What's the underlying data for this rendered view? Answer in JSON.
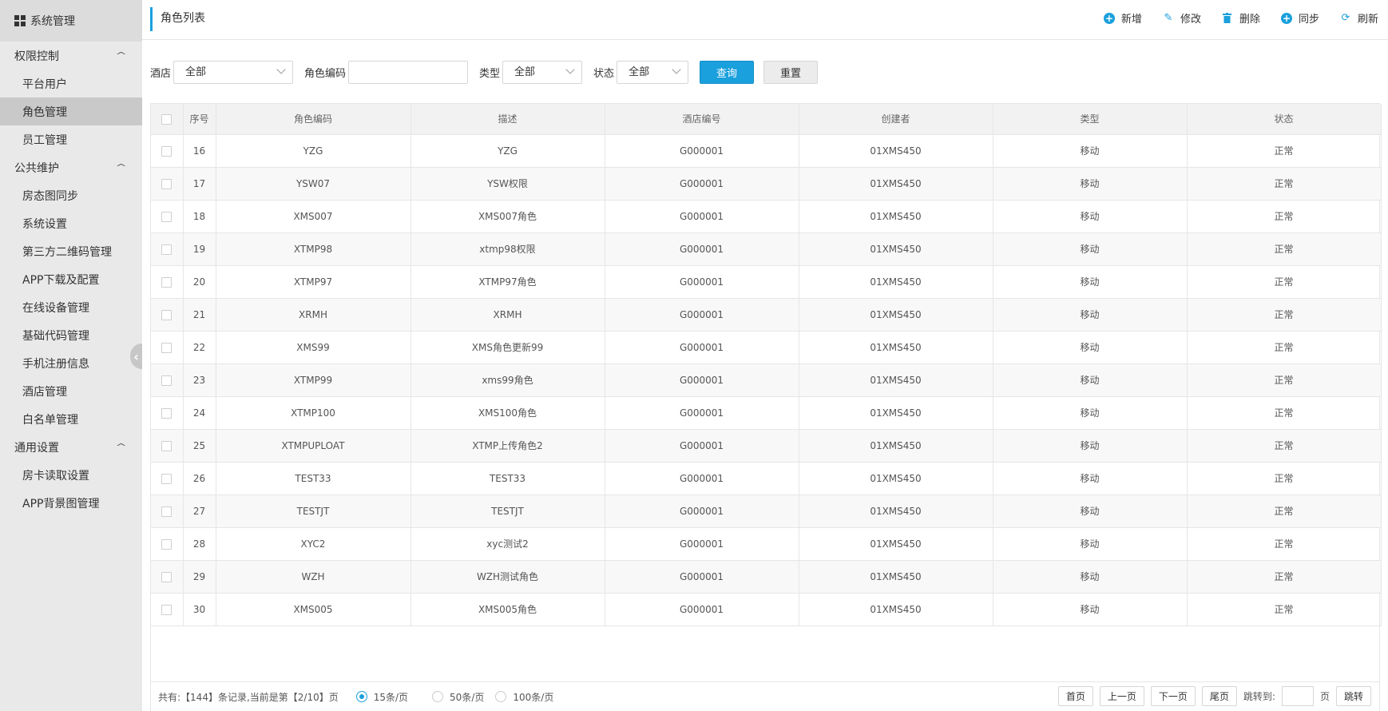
{
  "sidebar": {
    "title": "系统管理",
    "groups": [
      {
        "label": "权限控制",
        "items": [
          "平台用户",
          "角色管理",
          "员工管理"
        ]
      },
      {
        "label": "公共维护",
        "items": [
          "房态图同步",
          "系统设置",
          "第三方二维码管理",
          "APP下载及配置",
          "在线设备管理",
          "基础代码管理",
          "手机注册信息",
          "酒店管理",
          "白名单管理"
        ]
      },
      {
        "label": "通用设置",
        "items": [
          "房卡读取设置",
          "APP背景图管理"
        ]
      }
    ],
    "active_item": "角色管理",
    "collapse_icon": "‹"
  },
  "header": {
    "title": "角色列表",
    "toolbar": [
      {
        "label": "新增",
        "icon": "plus-circle-icon"
      },
      {
        "label": "修改",
        "icon": "edit-icon"
      },
      {
        "label": "删除",
        "icon": "trash-icon"
      },
      {
        "label": "同步",
        "icon": "sync-plus-icon"
      },
      {
        "label": "刷新",
        "icon": "refresh-icon"
      }
    ]
  },
  "filter": {
    "hotel_label": "酒店",
    "hotel_value": "全部",
    "code_label": "角色编码",
    "code_value": "",
    "type_label": "类型",
    "type_value": "全部",
    "status_label": "状态",
    "status_value": "全部",
    "query_label": "查询",
    "reset_label": "重置"
  },
  "table": {
    "columns": [
      "序号",
      "角色编码",
      "描述",
      "酒店编号",
      "创建者",
      "类型",
      "状态"
    ],
    "rows": [
      [
        "16",
        "YZG",
        "YZG",
        "G000001",
        "01XMS450",
        "移动",
        "正常"
      ],
      [
        "17",
        "YSW07",
        "YSW权限",
        "G000001",
        "01XMS450",
        "移动",
        "正常"
      ],
      [
        "18",
        "XMS007",
        "XMS007角色",
        "G000001",
        "01XMS450",
        "移动",
        "正常"
      ],
      [
        "19",
        "XTMP98",
        "xtmp98权限",
        "G000001",
        "01XMS450",
        "移动",
        "正常"
      ],
      [
        "20",
        "XTMP97",
        "XTMP97角色",
        "G000001",
        "01XMS450",
        "移动",
        "正常"
      ],
      [
        "21",
        "XRMH",
        "XRMH",
        "G000001",
        "01XMS450",
        "移动",
        "正常"
      ],
      [
        "22",
        "XMS99",
        "XMS角色更新99",
        "G000001",
        "01XMS450",
        "移动",
        "正常"
      ],
      [
        "23",
        "XTMP99",
        "xms99角色",
        "G000001",
        "01XMS450",
        "移动",
        "正常"
      ],
      [
        "24",
        "XTMP100",
        "XMS100角色",
        "G000001",
        "01XMS450",
        "移动",
        "正常"
      ],
      [
        "25",
        "XTMPUPLOAT",
        "XTMP上传角色2",
        "G000001",
        "01XMS450",
        "移动",
        "正常"
      ],
      [
        "26",
        "TEST33",
        "TEST33",
        "G000001",
        "01XMS450",
        "移动",
        "正常"
      ],
      [
        "27",
        "TESTJT",
        "TESTJT",
        "G000001",
        "01XMS450",
        "移动",
        "正常"
      ],
      [
        "28",
        "XYC2",
        "xyc测试2",
        "G000001",
        "01XMS450",
        "移动",
        "正常"
      ],
      [
        "29",
        "WZH",
        "WZH测试角色",
        "G000001",
        "01XMS450",
        "移动",
        "正常"
      ],
      [
        "30",
        "XMS005",
        "XMS005角色",
        "G000001",
        "01XMS450",
        "移动",
        "正常"
      ]
    ]
  },
  "pager": {
    "info": "共有:【144】条记录,当前是第【2/10】页",
    "page_sizes": [
      "15条/页",
      "50条/页",
      "100条/页"
    ],
    "selected_size": "15条/页",
    "first": "首页",
    "prev": "上一页",
    "next": "下一页",
    "last": "尾页",
    "jump_label": "跳转到:",
    "page_unit": "页",
    "jump_button": "跳转"
  },
  "colors": {
    "accent": "#1aa0dc",
    "sidebar_bg": "#e9e9e9",
    "sidebar_active": "#c9c9c9"
  }
}
